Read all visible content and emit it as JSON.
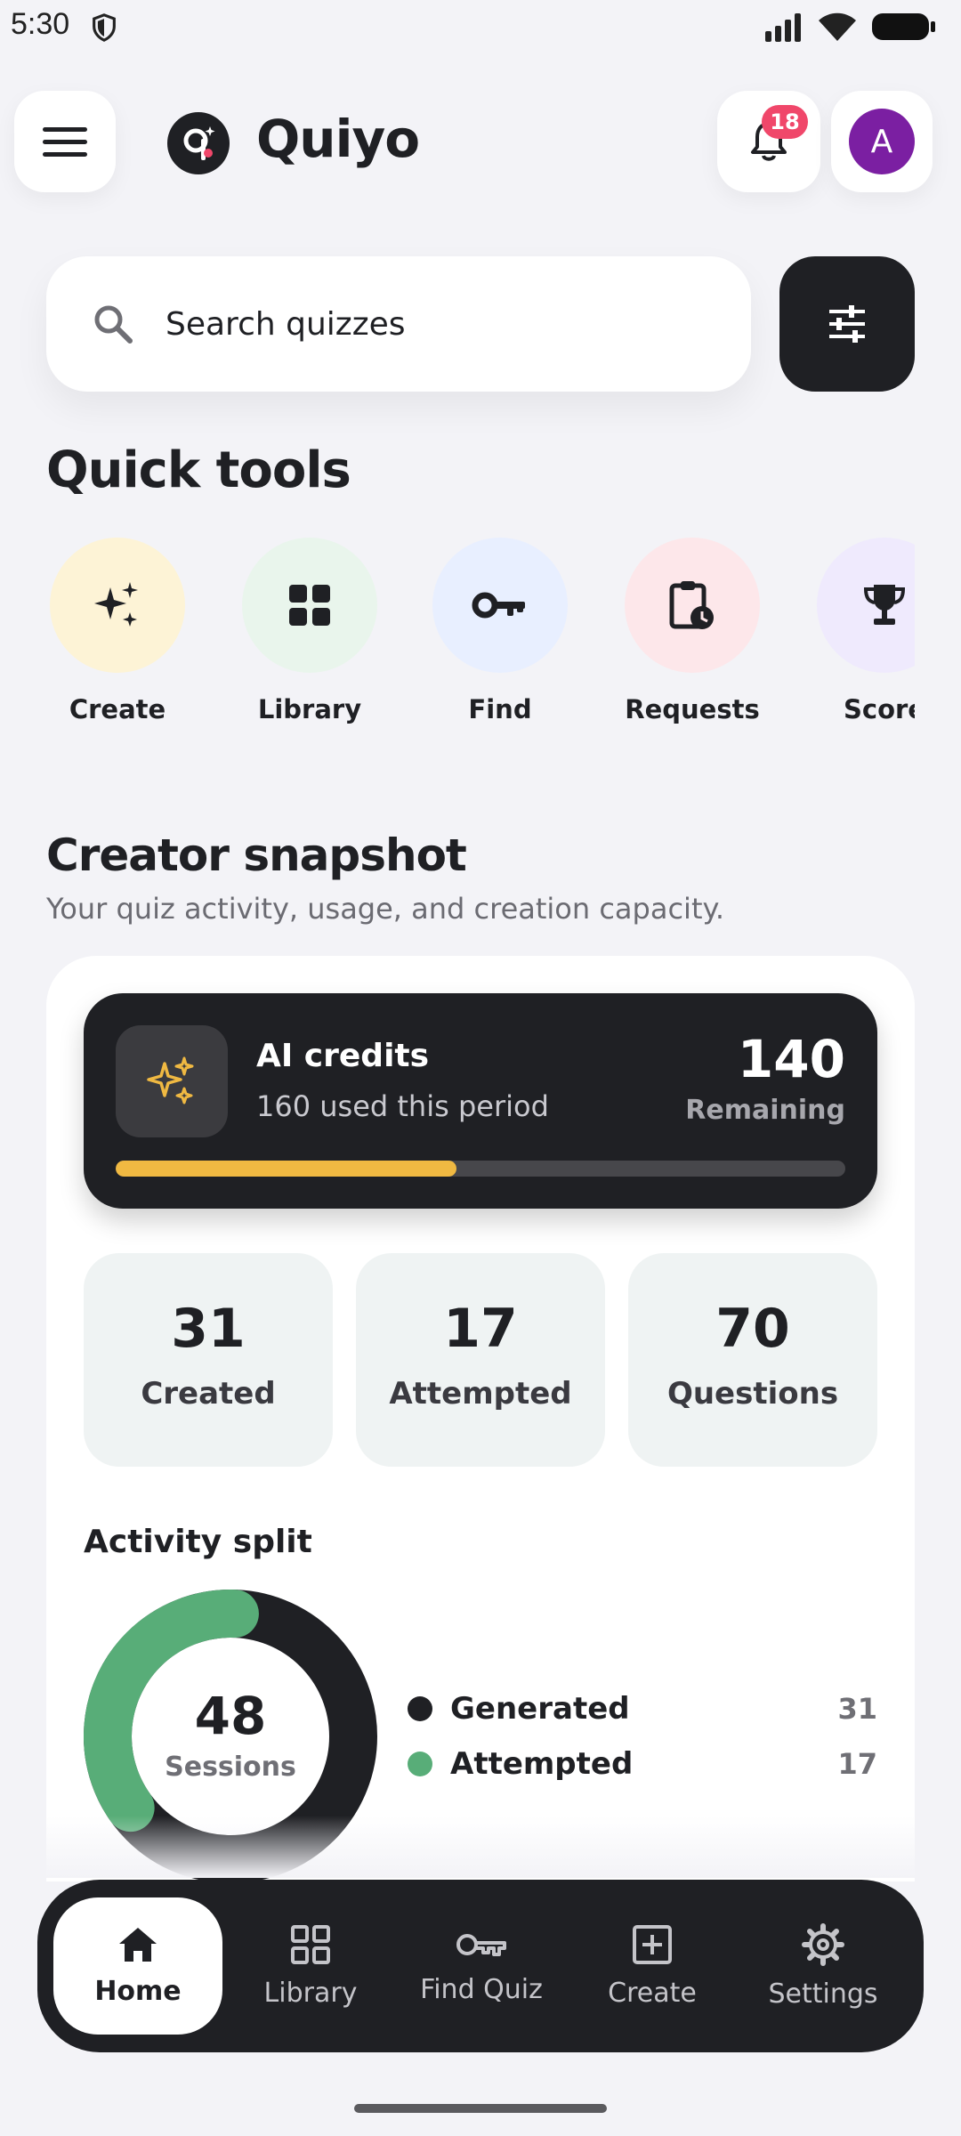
{
  "status_bar": {
    "time": "5:30"
  },
  "header": {
    "app_title": "Quiyo",
    "notification_count": "18",
    "avatar_initial": "A"
  },
  "search": {
    "placeholder": "Search quizzes"
  },
  "quick_tools": {
    "title": "Quick tools",
    "items": [
      {
        "label": "Create",
        "icon": "sparkles-icon",
        "bg": "#fdf3d6"
      },
      {
        "label": "Library",
        "icon": "grid-icon",
        "bg": "#e9f5ec"
      },
      {
        "label": "Find",
        "icon": "key-icon",
        "bg": "#e8efff"
      },
      {
        "label": "Requests",
        "icon": "clipboard-clock-icon",
        "bg": "#fde7ea"
      },
      {
        "label": "Score",
        "icon": "trophy-icon",
        "bg": "#efeafd"
      }
    ]
  },
  "snapshot": {
    "title": "Creator snapshot",
    "subtitle": "Your quiz activity, usage, and creation capacity.",
    "credits": {
      "title": "AI credits",
      "used_text": "160 used this period",
      "remaining_value": "140",
      "remaining_label": "Remaining",
      "used_fraction": 0.4667,
      "accent": "#f0b942"
    },
    "stats": [
      {
        "value": "31",
        "label": "Created"
      },
      {
        "value": "17",
        "label": "Attempted"
      },
      {
        "value": "70",
        "label": "Questions"
      }
    ],
    "activity_split": {
      "title": "Activity split",
      "total": "48",
      "total_label": "Sessions",
      "items": [
        {
          "name": "Generated",
          "value": "31",
          "color": "#1f2024"
        },
        {
          "name": "Attempted",
          "value": "17",
          "color": "#58ad78"
        }
      ]
    }
  },
  "bottom_nav": {
    "items": [
      {
        "label": "Home",
        "icon": "home-icon",
        "active": true
      },
      {
        "label": "Library",
        "icon": "grid-outline-icon",
        "active": false
      },
      {
        "label": "Find Quiz",
        "icon": "key-icon",
        "active": false
      },
      {
        "label": "Create",
        "icon": "plus-square-icon",
        "active": false
      },
      {
        "label": "Settings",
        "icon": "gear-icon",
        "active": false
      }
    ]
  }
}
